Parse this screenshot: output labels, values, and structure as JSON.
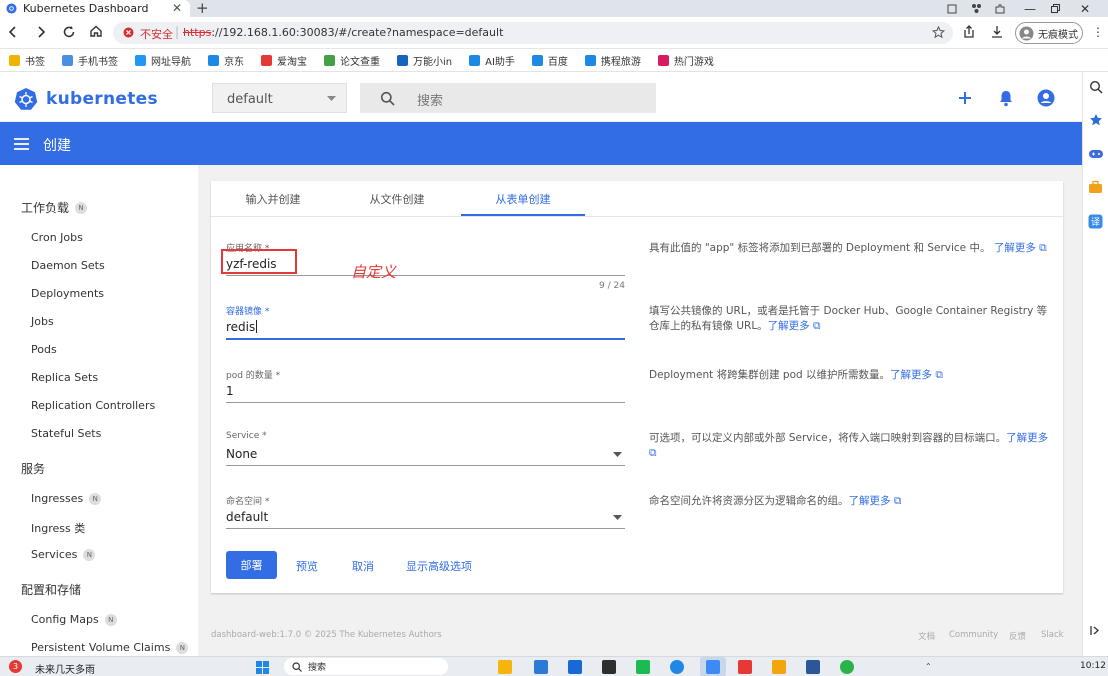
{
  "browser": {
    "tab_title": "Kubernetes Dashboard",
    "insecure_label": "不安全",
    "url_scheme": "https",
    "url_rest": "://192.168.1.60:30083/#/create?namespace=default",
    "incognito_label": "无痕模式"
  },
  "bookmarks": [
    {
      "label": "书签",
      "color": "#f0b400"
    },
    {
      "label": "手机书签",
      "color": "#4a90e2"
    },
    {
      "label": "网址导航",
      "color": "#2196f3"
    },
    {
      "label": "京东",
      "color": "#1e88e5"
    },
    {
      "label": "爱淘宝",
      "color": "#e53935"
    },
    {
      "label": "论文查重",
      "color": "#43a047"
    },
    {
      "label": "万能小in",
      "color": "#1565c0"
    },
    {
      "label": "AI助手",
      "color": "#1e88e5"
    },
    {
      "label": "百度",
      "color": "#1e88e5"
    },
    {
      "label": "携程旅游",
      "color": "#1e88e5"
    },
    {
      "label": "热门游戏",
      "color": "#d81b60"
    }
  ],
  "header": {
    "brand": "kubernetes",
    "namespace_value": "default",
    "search_placeholder": "搜索"
  },
  "page_title": "创建",
  "nav": {
    "workloads_title": "工作负载",
    "workloads": [
      "Cron Jobs",
      "Daemon Sets",
      "Deployments",
      "Jobs",
      "Pods",
      "Replica Sets",
      "Replication Controllers",
      "Stateful Sets"
    ],
    "services_title": "服务",
    "services": [
      "Ingresses",
      "Ingress 类",
      "Services"
    ],
    "config_title": "配置和存储",
    "config": [
      "Config Maps",
      "Persistent Volume Claims"
    ],
    "badge": "N"
  },
  "tabs": [
    "输入并创建",
    "从文件创建",
    "从表单创建"
  ],
  "form": {
    "app_name_label": "应用名称 *",
    "app_name_value": "yzf-redis",
    "app_name_counter": "9 / 24",
    "annotation": "自定义",
    "image_label": "容器镜像 *",
    "image_value": "redis",
    "pods_label": "pod 的数量 *",
    "pods_value": "1",
    "service_label": "Service *",
    "service_value": "None",
    "namespace_label": "命名空间 *",
    "namespace_value": "default"
  },
  "help": {
    "app_name": "具有此值的 \"app\" 标签将添加到已部署的 Deployment 和 Service 中。",
    "image": "填写公共镜像的 URL，或者是托管于 Docker Hub、Google Container Registry 等仓库上的私有镜像 URL。",
    "pods": "Deployment 将跨集群创建 pod 以维护所需数量。",
    "service": "可选项，可以定义内部或外部 Service，将传入端口映射到容器的目标端口。",
    "namespace": "命名空间允许将资源分区为逻辑命名的组。",
    "learn_more": "了解更多"
  },
  "buttons": {
    "deploy": "部署",
    "preview": "预览",
    "cancel": "取消",
    "advanced": "显示高级选项"
  },
  "footer": {
    "copyright": "dashboard-web:1.7.0 © 2025 The Kubernetes Authors",
    "links": [
      "文档",
      "Community",
      "反馈",
      "Slack"
    ]
  },
  "taskbar": {
    "weather_badge": "3",
    "weather_text": "未来几天多雨",
    "search_label": "搜索",
    "time": "10:12"
  },
  "colors": {
    "k8s_blue": "#326de6",
    "highlight_red": "#e53935"
  }
}
